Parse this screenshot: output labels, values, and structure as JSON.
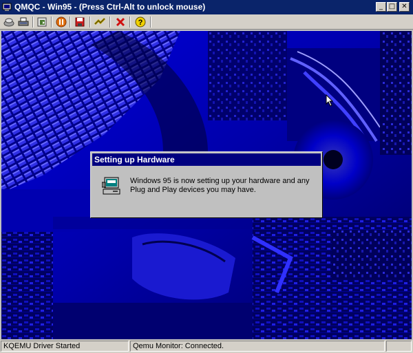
{
  "window": {
    "title": "QMQC - Win95 - (Press Ctrl-Alt to unlock mouse)",
    "buttons": [
      "minimize",
      "maximize",
      "close"
    ]
  },
  "toolbar": {
    "icons": [
      "floppy-drive-icon",
      "printer-icon",
      "cdrom-icon",
      "pause-icon",
      "save-icon",
      "connect-icon",
      "stop-icon",
      "help-icon"
    ]
  },
  "dialog": {
    "title": "Setting up Hardware",
    "message": "Windows 95 is now setting up your hardware and any Plug and Play devices you may have.",
    "icon": "computer-setup-icon"
  },
  "statusbar": {
    "left": "KQEMU Driver Started",
    "middle": "Qemu Monitor: Connected.",
    "right": ""
  },
  "colors": {
    "titlebar": "#0a246a",
    "dialog_title": "#000080",
    "desktop_blue": "#0000c8",
    "chrome": "#d4d0c8"
  }
}
